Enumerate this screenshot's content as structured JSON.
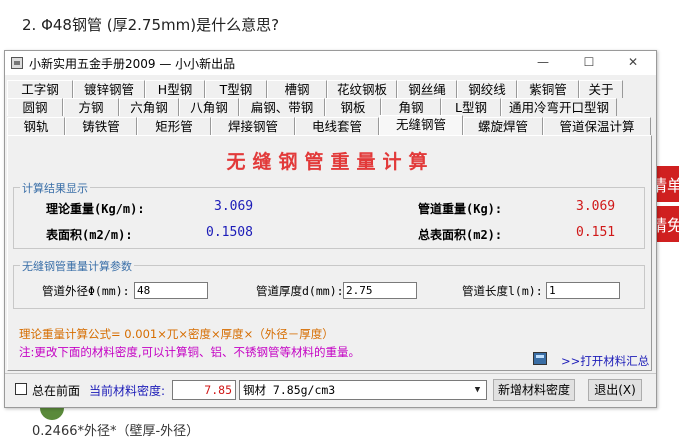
{
  "background": {
    "question": "2.  Φ48钢管 (厚2.75mm)是什么意思?",
    "bottom_text": "0.2466*外径*（壁厚-外径）",
    "red_tag_1": "情单",
    "red_tag_2": "请免"
  },
  "window": {
    "title": "小新实用五金手册2009 — 小小新出品",
    "minimize": "—",
    "maximize": "☐",
    "close": "✕"
  },
  "tabs": {
    "row1": [
      "工字钢",
      "镀锌钢管",
      "H型钢",
      "T型钢",
      "槽钢",
      "花纹钢板",
      "钢丝绳",
      "钢绞线",
      "紫铜管",
      "关于"
    ],
    "row2": [
      "圆钢",
      "方钢",
      "六角钢",
      "八角钢",
      "扁钢、带钢",
      "钢板",
      "角钢",
      "L型钢",
      "通用冷弯开口型钢"
    ],
    "row3": [
      "钢轨",
      "铸铁管",
      "矩形管",
      "焊接钢管",
      "电线套管",
      "无缝钢管",
      "螺旋焊管",
      "管道保温计算"
    ],
    "active": "无缝钢管"
  },
  "heading": "无缝钢管重量计算",
  "result_group": {
    "title": "计算结果显示",
    "theory_weight_label": "理论重量(Kg/m):",
    "theory_weight_value": "3.069",
    "surface_area_label": "表面积(m2/m):",
    "surface_area_value": "0.1508",
    "pipe_weight_label": "管道重量(Kg):",
    "pipe_weight_value": "3.069",
    "total_area_label": "总表面积(m2):",
    "total_area_value": "0.151"
  },
  "params_group": {
    "title": "无缝钢管重量计算参数",
    "outer_dia_label": "管道外径Φ(mm):",
    "outer_dia_value": "48",
    "thickness_label": "管道厚度d(mm):",
    "thickness_value": "2.75",
    "length_label": "管道长度l(m):",
    "length_value": "1"
  },
  "formula": "理论重量计算公式= 0.001×兀×密度×厚度×（外径－厚度）",
  "note": "注:更改下面的材料密度,可以计算铜、铝、不锈钢管等材料的重量。",
  "open_summary_link": ">>打开材料汇总",
  "bottom": {
    "always_on_top_label": "总在前面",
    "density_label": "当前材料密度:",
    "density_value": "7.85",
    "material_select": "钢材 7.85g/cm3",
    "add_material_button": "新增材料密度",
    "exit_button": "退出(X)"
  }
}
